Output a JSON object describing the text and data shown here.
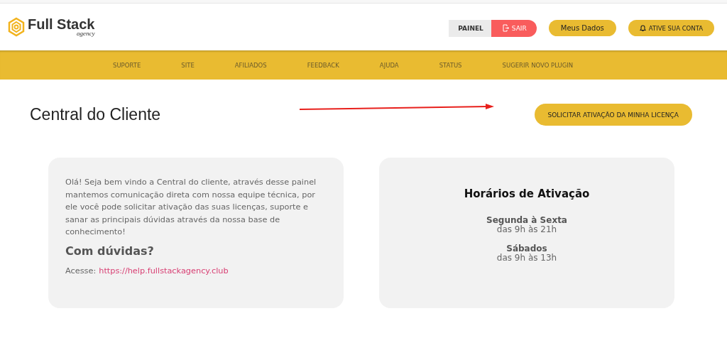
{
  "logo": {
    "name": "Full Stack",
    "tagline": "agency"
  },
  "header_buttons": [
    {
      "label": "PAINEL",
      "kind": "plain"
    },
    {
      "label": "SAIR",
      "kind": "logout"
    },
    {
      "label": "Meus Dados",
      "kind": "pill"
    },
    {
      "label": "ATIVE SUA CONTA",
      "kind": "bell"
    }
  ],
  "nav": [
    "SUPORTE",
    "SITE",
    "AFILIADOS",
    "FEEDBACK",
    "AJUDA",
    "STATUS",
    "SUGERIR NOVO PLUGIN"
  ],
  "page_title": "Central do Cliente",
  "action_button": "SOLICITAR ATIVAÇÃO DA MINHA LICENÇA",
  "welcome_card": {
    "text": "Olá! Seja bem vindo a Central do cliente, através desse painel mantemos comunicação direta com nossa equipe técnica, por ele você pode solicitar ativação das suas licenças, suporte e sanar as principais dúvidas através da nossa base de conhecimento!",
    "heading": "Com dúvidas?",
    "link_label": "Acesse:",
    "link": "https://help.fullstackagency.club"
  },
  "hours_card": {
    "title": "Horários de Ativação",
    "schedules": [
      {
        "days": "Segunda à Sexta",
        "hours": "das 9h às 21h"
      },
      {
        "days": "Sábados",
        "hours": "das 9h às 13h"
      }
    ]
  }
}
